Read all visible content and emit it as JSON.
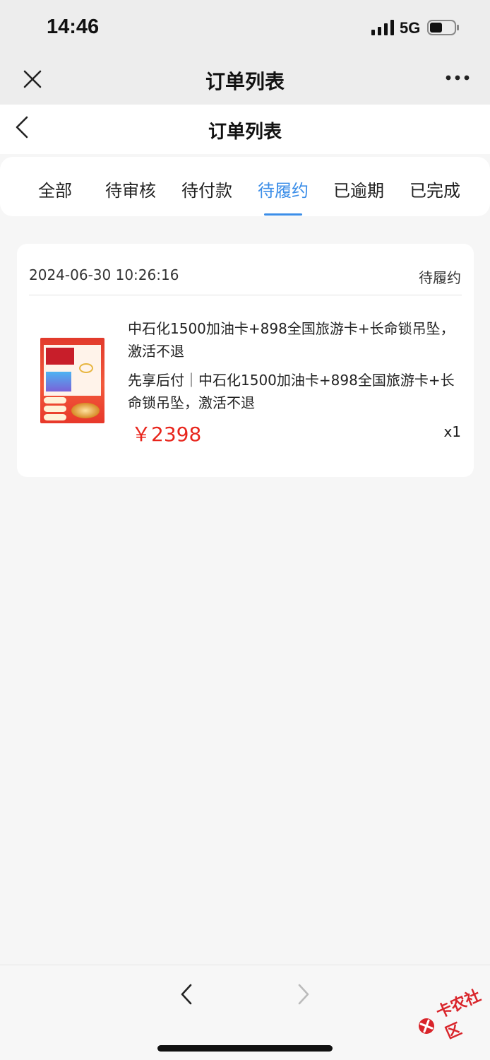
{
  "status_bar": {
    "time": "14:46",
    "network": "5G"
  },
  "wechat_nav": {
    "title": "订单列表",
    "close_icon": "close-icon",
    "more_icon": "more-dots-icon"
  },
  "page_header": {
    "title": "订单列表",
    "back_icon": "chevron-left-icon"
  },
  "tabs": [
    {
      "label": "全部",
      "active": false
    },
    {
      "label": "待审核",
      "active": false
    },
    {
      "label": "待付款",
      "active": false
    },
    {
      "label": "待履约",
      "active": true
    },
    {
      "label": "已逾期",
      "active": false
    },
    {
      "label": "已完成",
      "active": false
    }
  ],
  "order": {
    "datetime": "2024-06-30 10:26:16",
    "status": "待履约",
    "product_name": "中石化1500加油卡+898全国旅游卡+长命锁吊坠，激活不退",
    "product_desc": "先享后付｜中石化1500加油卡+898全国旅游卡+长命锁吊坠，激活不退",
    "price": "￥2398",
    "quantity": "x1"
  },
  "colors": {
    "accent": "#3c8ee8",
    "price": "#e8251c",
    "background": "#f6f6f6"
  },
  "bottom_nav": {
    "back_icon": "chevron-left-icon",
    "forward_icon": "chevron-right-icon"
  },
  "watermark": {
    "text": "卡农社区"
  }
}
